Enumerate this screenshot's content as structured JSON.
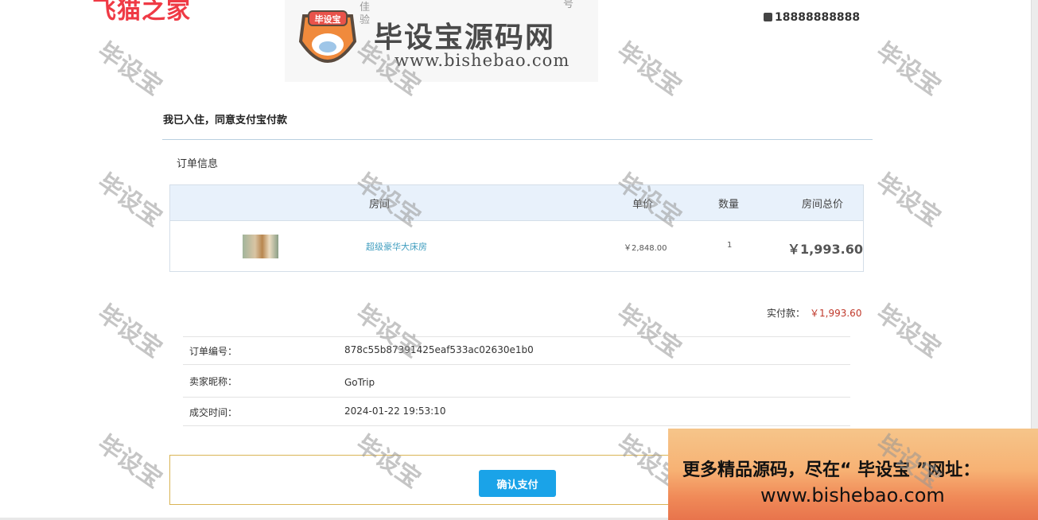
{
  "header": {
    "brand": "飞猫之家",
    "phone": "18888888888",
    "logo_title": "毕设宝源码网",
    "logo_url": "www.bishebao.com",
    "mascot_badge": "毕设宝",
    "frag_a": "佳",
    "frag_b": "验",
    "frag_c": "号"
  },
  "confirm": {
    "title": "我已入住，同意支付宝付款"
  },
  "order": {
    "section_title": "订单信息",
    "columns": [
      "房间",
      "单价",
      "数量",
      "房间总价"
    ],
    "row": {
      "room_name": "超级豪华大床房",
      "unit_price": "￥2,848.00",
      "quantity": "1",
      "total": "￥1,993.60"
    }
  },
  "payment": {
    "paid_label": "实付款：",
    "paid_amount": "￥1,993.60"
  },
  "details": [
    {
      "label": "订单编号：",
      "value": "878c55b87391425eaf533ac02630e1b0"
    },
    {
      "label": "卖家昵称：",
      "value": "GoTrip"
    },
    {
      "label": "成交时间：",
      "value": "2024-01-22 19:53:10"
    }
  ],
  "actions": {
    "pay_button": "确认支付"
  },
  "watermark": "毕设宝",
  "promo": {
    "line1": "更多精品源码，尽在“ 毕设宝 ”网址：",
    "line2": "www.bishebao.com"
  },
  "colors": {
    "accent": "#1aa3e8",
    "price_red": "#c0392b",
    "link_blue": "#3f9dbf",
    "table_head": "#e8f1fb"
  }
}
